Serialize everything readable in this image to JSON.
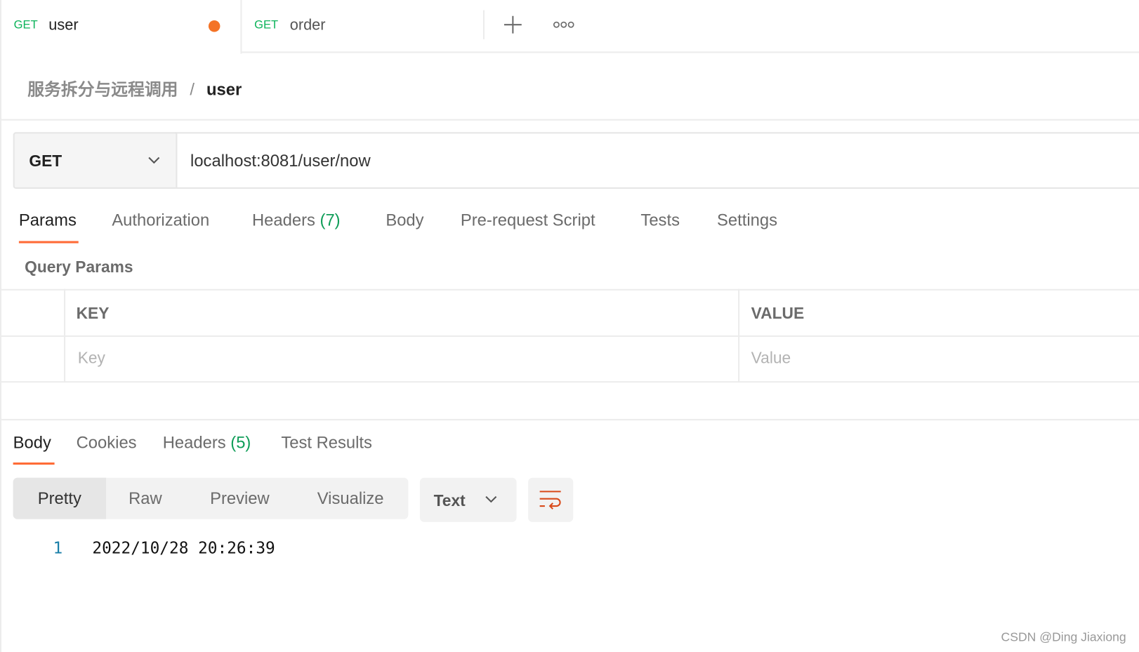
{
  "tabs": [
    {
      "method": "GET",
      "name": "user",
      "unsaved": true
    },
    {
      "method": "GET",
      "name": "order"
    }
  ],
  "tab_actions": {
    "new_tab": "plus-icon",
    "more": "more-horizontal-icon"
  },
  "breadcrumb": {
    "collection": "服务拆分与远程调用",
    "separator": "/",
    "request": "user"
  },
  "request": {
    "method": "GET",
    "url": "localhost:8081/user/now"
  },
  "request_tabs": [
    {
      "label": "Params",
      "active": true
    },
    {
      "label": "Authorization"
    },
    {
      "label": "Headers",
      "count": "(7)"
    },
    {
      "label": "Body"
    },
    {
      "label": "Pre-request Script"
    },
    {
      "label": "Tests"
    },
    {
      "label": "Settings"
    }
  ],
  "query_params": {
    "title": "Query Params",
    "columns": [
      "KEY",
      "VALUE"
    ],
    "placeholders": {
      "key": "Key",
      "value": "Value"
    }
  },
  "response_tabs": [
    {
      "label": "Body",
      "active": true
    },
    {
      "label": "Cookies"
    },
    {
      "label": "Headers",
      "count": "(5)"
    },
    {
      "label": "Test Results"
    }
  ],
  "view_modes": [
    "Pretty",
    "Raw",
    "Preview",
    "Visualize"
  ],
  "format": "Text",
  "response_lines": [
    {
      "num": "1",
      "text": "2022/10/28 20:26:39"
    }
  ],
  "watermark": "CSDN @Ding Jiaxiong",
  "colors": {
    "accent": "#ff6c37",
    "method_green": "#0cb35a",
    "count_green": "#0f9d58"
  }
}
